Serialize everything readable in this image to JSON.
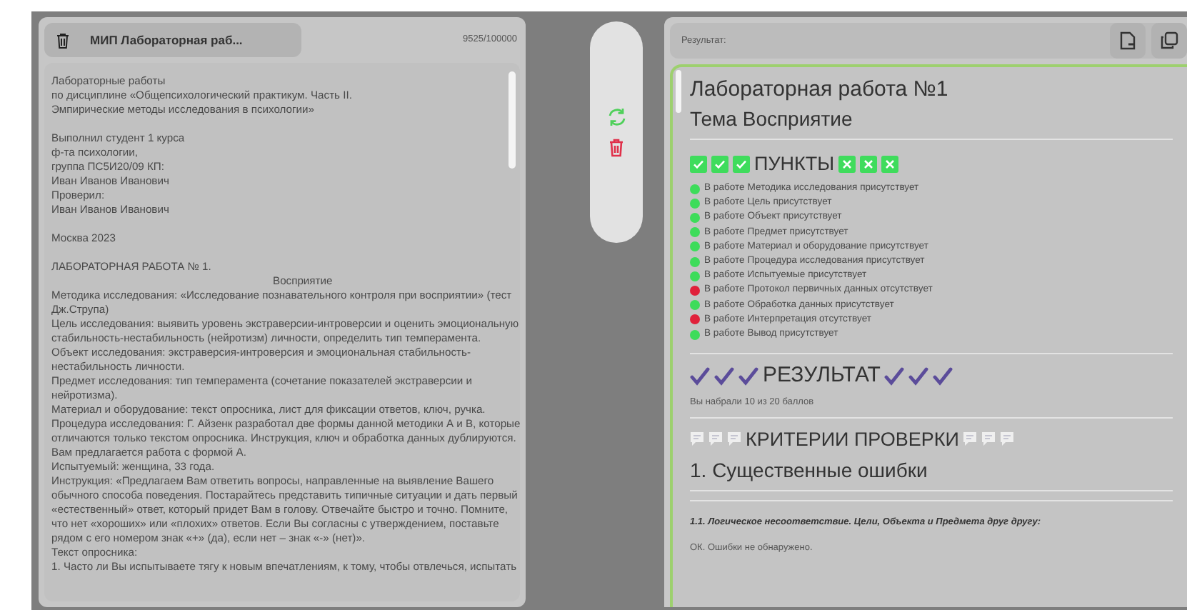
{
  "left_panel": {
    "tab": {
      "title": "МИП Лабораторная раб..."
    },
    "counter": "9525/100000",
    "blocks": [
      [
        {
          "text": "Лабораторные работы",
          "kind": "plain"
        },
        {
          "text": "по дисциплине «Общепсихологический практикум. Часть II.",
          "kind": "plain"
        },
        {
          "text": "Эмпирические методы исследования в психологии»",
          "kind": "plain"
        }
      ],
      [
        {
          "text": "Выполнил студент 1 курса",
          "kind": "plain"
        },
        {
          "text": "ф-та психологии,",
          "kind": "plain"
        },
        {
          "text": "группа ПС5И20/09 КП:",
          "kind": "plain"
        },
        {
          "text": "Иван Иванов Иванович",
          "kind": "plain"
        },
        {
          "text": "Проверил:",
          "kind": "plain"
        },
        {
          "text": "Иван Иванов Иванович",
          "kind": "plain"
        }
      ],
      [
        {
          "text": "Москва 2023",
          "kind": "plain"
        }
      ],
      [
        {
          "text": "ЛАБОРАТОРНАЯ РАБОТА № 1.",
          "kind": "plain"
        },
        {
          "text": "Восприятие",
          "kind": "centered"
        },
        {
          "text": "Методика исследования: «Исследование познавательного контроля при восприятии» (тест",
          "kind": "plain"
        },
        {
          "text": "Дж.Струпа)",
          "kind": "plain"
        },
        {
          "text": "Цель исследования: выявить уровень экстраверсии-интроверсии и оценить эмоциональную",
          "kind": "plain"
        },
        {
          "text": "стабильность-нестабильность (нейротизм) личности, определить тип темперамента.",
          "kind": "plain"
        },
        {
          "text": "Объект исследования: экстраверсия-интроверсия и эмоциональная стабильность-",
          "kind": "plain"
        },
        {
          "text": "нестабильность личности.",
          "kind": "plain"
        },
        {
          "text": "Предмет исследования: тип темперамента (сочетание показателей экстраверсии и",
          "kind": "plain"
        },
        {
          "text": "нейротизма).",
          "kind": "plain"
        },
        {
          "text": "Материал и оборудование: текст опросника, лист для фиксации ответов, ключ, ручка.",
          "kind": "plain"
        },
        {
          "text": "Процедура исследования: Г. Айзенк разработал две формы данной методики А и В, которые",
          "kind": "plain"
        },
        {
          "text": "отличаются только текстом опросника. Инструкция, ключ и обработка данных дублируются.",
          "kind": "plain"
        },
        {
          "text": "Вам предлагается работа с формой А.",
          "kind": "plain"
        },
        {
          "text": "Испытуемый: женщина, 33 года.",
          "kind": "plain"
        },
        {
          "text": "Инструкция: «Предлагаем Вам ответить вопросы, направленные на выявление Вашего",
          "kind": "plain"
        },
        {
          "text": "обычного способа поведения. Постарайтесь представить типичные ситуации и дать первый",
          "kind": "plain"
        },
        {
          "text": "«естественный» ответ, который придет Вам в голову. Отвечайте быстро и точно. Помните,",
          "kind": "plain"
        },
        {
          "text": "что нет «хороших» или «плохих» ответов. Если Вы согласны с утверждением, поставьте",
          "kind": "plain"
        },
        {
          "text": "рядом с его номером знак «+» (да), если нет – знак «-» (нет)».",
          "kind": "plain"
        },
        {
          "text": "Текст опросника:",
          "kind": "plain"
        },
        {
          "text": "1. Часто ли Вы испытываете тягу к новым впечатлениям, к тому, чтобы отвлечься, испытать",
          "kind": "plain"
        }
      ]
    ]
  },
  "result_panel": {
    "label": "Результат:",
    "title": "Лабораторная работа №1",
    "topic": "Тема Восприятие",
    "points_heading": "ПУНКТЫ",
    "checklist": [
      {
        "text": "В работе Методика исследования присутствует",
        "color": "#3ddc5a"
      },
      {
        "text": "В работе Цель присутствует",
        "color": "#3ddc5a"
      },
      {
        "text": "В работе Объект присутствует",
        "color": "#3ddc5a"
      },
      {
        "text": "В работе Предмет присутствует",
        "color": "#3ddc5a"
      },
      {
        "text": "В работе Материал и оборудование присутствует",
        "color": "#3ddc5a"
      },
      {
        "text": "В работе Процедура исследования присутствует",
        "color": "#3ddc5a"
      },
      {
        "text": "В работе Испытуемые присутствует",
        "color": "#3ddc5a"
      },
      {
        "text": "В работе Протокол первичных данных отсутствует",
        "color": "#e0203a"
      },
      {
        "text": "В работе Обработка данных присутствует",
        "color": "#3ddc5a"
      },
      {
        "text": "В работе Интерпретация отсутствует",
        "color": "#e0203a"
      },
      {
        "text": "В работе Вывод присутствует",
        "color": "#3ddc5a"
      }
    ],
    "result_heading": "РЕЗУЛЬТАТ",
    "score": "Вы набрали 10 из 20 баллов",
    "criteria_heading": "КРИТЕРИИ ПРОВЕРКИ",
    "section_title": "1. Существенные ошибки",
    "criterion": "1.1. Логическое несоответствие. Цели, Объекта и Предмета друг другу:",
    "criterion_result": "ОК. Ошибки не обнаружено."
  }
}
